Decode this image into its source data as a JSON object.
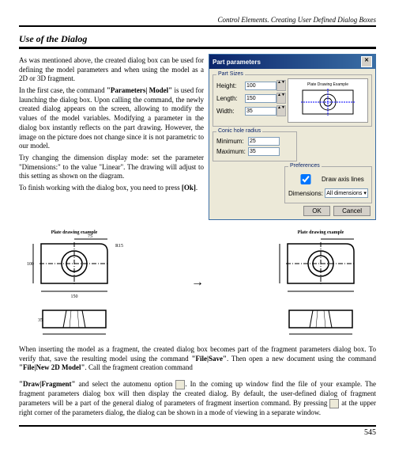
{
  "hdr": "Control Elements. Creating User Defined Dialog Boxes",
  "title": "Use of the Dialog",
  "p1": "As was mentioned above, the created dialog box can be used for defining the model parameters and when using the model as a 2D or 3D fragment.",
  "p2a": "In the first case, the command ",
  "p2b": "\"Parameters| Model\"",
  "p2c": " is used for launching the dialog box. Upon calling the command, the newly created dialog appears on the screen, allowing to modify the values of the model variables. Modifying a parameter in the dialog box instantly reflects on the part drawing. However, the image on the picture does not change since it is not parametric to our model.",
  "p3": "Try changing the dimension display mode: set the parameter \"Dimensions:\" to the value \"Linear\". The drawing will adjust to this setting as shown on the diagram.",
  "p4a": "To finish working with the dialog box, you need to press ",
  "p4b": "[Ok]",
  "p4c": ".",
  "p5a": "When inserting the model as a fragment, the created dialog box becomes part of the fragment parameters dialog box. To verify that, save the resulting model using the command ",
  "p5b": "\"File|Save\"",
  "p5c": ". Then open a new document using the command ",
  "p5d": "\"File|New 2D Model\"",
  "p5e": ". Call the fragment creation command ",
  "p6a": "\"Draw|Fragment\"",
  "p6b": " and select the automenu option ",
  "p6c": ". In the coming up window find the file of your example. The fragment parameters dialog box will then display the created dialog. By default, the user-defined dialog of fragment parameters will be a part of the general dialog of parameters of fragment insertion command. By pressing ",
  "p6d": " at the upper right corner of the parameters dialog, the dialog can be shown in a mode of viewing in a separate window.",
  "dlg": {
    "title": "Part parameters",
    "sizes": {
      "legend": "Part Sizes",
      "height_l": "Height:",
      "height_v": "100",
      "length_l": "Length:",
      "length_v": "150",
      "width_l": "Width:",
      "width_v": "35"
    },
    "conic": {
      "legend": "Conic hole radius",
      "min_l": "Minimum:",
      "min_v": "25",
      "max_l": "Maximum:",
      "max_v": "35"
    },
    "prefs": {
      "legend": "Preferences",
      "axis": "Draw axis lines",
      "dim_l": "Dimensions:",
      "dim_v": "All dimensions"
    },
    "preview": "Plate Drawing Example",
    "ok": "OK",
    "cancel": "Cancel"
  },
  "diag": {
    "label1": "Plate drawing example",
    "label2": "Plate drawing example"
  },
  "page": "545"
}
